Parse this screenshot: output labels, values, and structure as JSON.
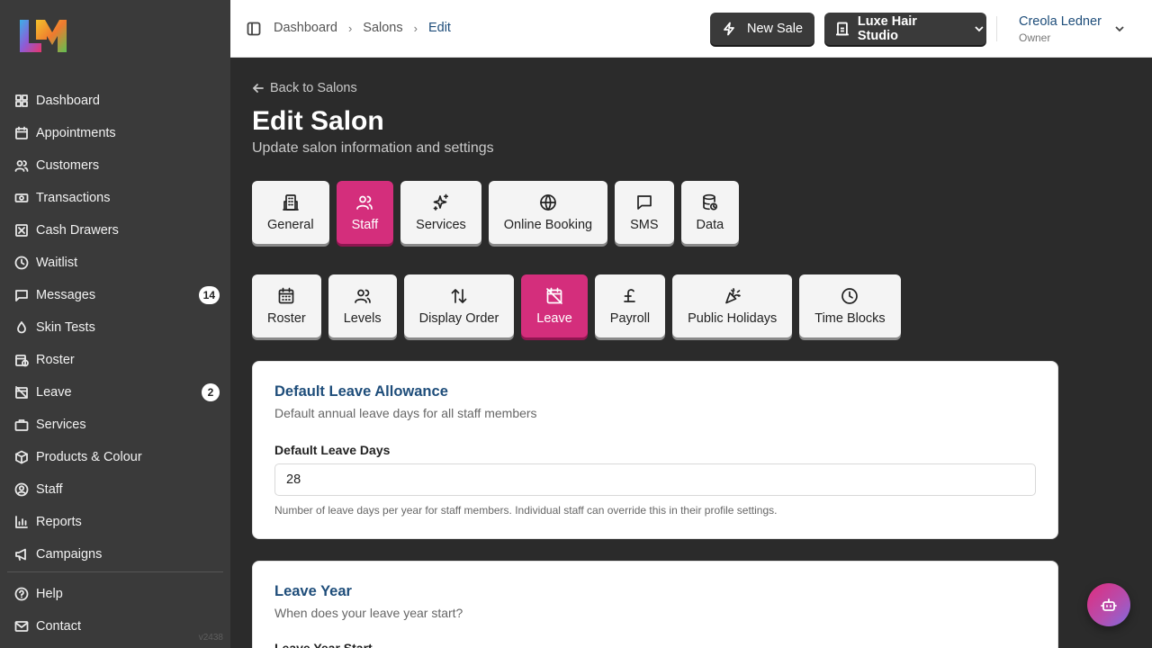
{
  "app": {
    "version": "v2438",
    "brand_colors": {
      "accent": "#d42e7c",
      "link": "#1e4d7a",
      "sidebar_bg": "#3a3a3a"
    }
  },
  "sidebar": {
    "logo_icon": "lm-logo-icon",
    "items": [
      {
        "label": "Dashboard",
        "icon": "grid-icon"
      },
      {
        "label": "Appointments",
        "icon": "calendar-icon"
      },
      {
        "label": "Customers",
        "icon": "users-icon"
      },
      {
        "label": "Transactions",
        "icon": "banknote-icon"
      },
      {
        "label": "Cash Drawers",
        "icon": "cash-drawer-icon"
      },
      {
        "label": "Waitlist",
        "icon": "clock-icon"
      },
      {
        "label": "Messages",
        "icon": "message-icon",
        "badge": "14"
      },
      {
        "label": "Skin Tests",
        "icon": "droplet-icon"
      },
      {
        "label": "Roster",
        "icon": "calendar-clock-icon"
      },
      {
        "label": "Leave",
        "icon": "calendar-off-icon",
        "badge": "2"
      },
      {
        "label": "Services",
        "icon": "briefcase-icon"
      },
      {
        "label": "Products & Colour",
        "icon": "package-icon"
      },
      {
        "label": "Staff",
        "icon": "user-circle-icon"
      },
      {
        "label": "Reports",
        "icon": "bar-chart-icon"
      },
      {
        "label": "Campaigns",
        "icon": "megaphone-icon"
      }
    ],
    "bottom_items": [
      {
        "label": "Help",
        "icon": "help-circle-icon"
      },
      {
        "label": "Contact",
        "icon": "mail-icon"
      }
    ]
  },
  "header": {
    "breadcrumb": [
      "Dashboard",
      "Salons",
      "Edit"
    ],
    "new_sale_label": "New Sale",
    "salon_label": "Luxe Hair Studio",
    "user_name": "Creola Ledner",
    "user_role": "Owner"
  },
  "page": {
    "back_label": "Back to Salons",
    "title": "Edit Salon",
    "subtitle": "Update salon information and settings"
  },
  "main_tabs": [
    {
      "label": "General",
      "icon": "building-icon",
      "active": false
    },
    {
      "label": "Staff",
      "icon": "users-icon",
      "active": true
    },
    {
      "label": "Services",
      "icon": "sparkles-icon",
      "active": false
    },
    {
      "label": "Online Booking",
      "icon": "globe-icon",
      "active": false
    },
    {
      "label": "SMS",
      "icon": "message-square-icon",
      "active": false
    },
    {
      "label": "Data",
      "icon": "database-icon",
      "active": false
    }
  ],
  "sub_tabs": [
    {
      "label": "Roster",
      "icon": "calendar-grid-icon",
      "active": false
    },
    {
      "label": "Levels",
      "icon": "users-icon",
      "active": false
    },
    {
      "label": "Display Order",
      "icon": "sort-arrows-icon",
      "active": false
    },
    {
      "label": "Leave",
      "icon": "calendar-off-icon",
      "active": true
    },
    {
      "label": "Payroll",
      "icon": "pound-icon",
      "active": false
    },
    {
      "label": "Public Holidays",
      "icon": "party-popper-icon",
      "active": false
    },
    {
      "label": "Time Blocks",
      "icon": "clock-icon",
      "active": false
    }
  ],
  "allowance_card": {
    "title": "Default Leave Allowance",
    "description": "Default annual leave days for all staff members",
    "field_label": "Default Leave Days",
    "field_value": "28",
    "help": "Number of leave days per year for staff members. Individual staff can override this in their profile settings."
  },
  "leave_year_card": {
    "title": "Leave Year",
    "description": "When does your leave year start?",
    "field_label": "Leave Year Start"
  },
  "chat_fab_icon": "bot-icon"
}
